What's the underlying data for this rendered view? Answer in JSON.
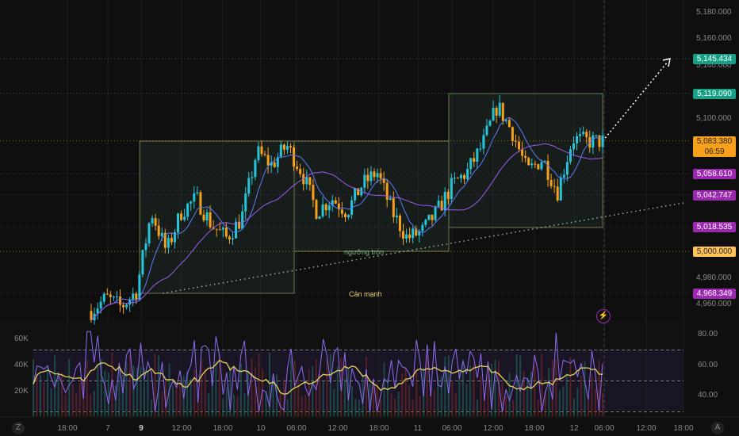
{
  "chart_data": {
    "type": "candlestick",
    "price_axis": {
      "ticks": [
        "5,180.000",
        "5,160.000",
        "5,140.000",
        "5,100.000",
        "4,980.000",
        "4,960.000"
      ],
      "range": [
        4955,
        5185
      ]
    },
    "price_labels": [
      {
        "value": 5145.434,
        "text": "5,145.434",
        "color": "#16a085"
      },
      {
        "value": 5119.09,
        "text": "5,119.090",
        "color": "#16a085"
      },
      {
        "value": 5083.38,
        "text": "5,083.380",
        "sub": "06:59",
        "color": "#f7a11a"
      },
      {
        "value": 5058.61,
        "text": "5,058.610",
        "color": "#9c27b0"
      },
      {
        "value": 5042.747,
        "text": "5,042.747",
        "color": "#9c27b0"
      },
      {
        "value": 5018.535,
        "text": "5,018.535",
        "color": "#9c27b0"
      },
      {
        "value": 5000.0,
        "text": "5,000.000",
        "color": "#ffc35a"
      },
      {
        "value": 4968.349,
        "text": "4,968.349",
        "color": "#9c27b0"
      }
    ],
    "time_ticks": [
      "18:00",
      "7",
      "9",
      "12:00",
      "18:00",
      "10",
      "06:00",
      "12:00",
      "18:00",
      "11",
      "06:00",
      "12:00",
      "18:00",
      "12",
      "06:00",
      "12:00",
      "18:00"
    ],
    "close_path": [
      4955,
      4965,
      4958,
      4970,
      5030,
      5000,
      5030,
      5040,
      5020,
      5010,
      5025,
      5075,
      5065,
      5080,
      5060,
      5030,
      5040,
      5030,
      5050,
      5060,
      5030,
      5010,
      5015,
      5030,
      5050,
      5060,
      5080,
      5110,
      5090,
      5060,
      5070,
      5045,
      5085,
      5083,
      5083
    ],
    "annotations": {
      "round_threshold": "ngưỡng tròn",
      "strong_resistance": "Cản mạnh"
    },
    "indicator": {
      "left_ticks": [
        "60K",
        "40K",
        "20K"
      ],
      "right_ticks": [
        "80.00",
        "60.00",
        "40.00"
      ],
      "levels": [
        70,
        50,
        30
      ]
    },
    "colors": {
      "up": "#26c6da",
      "down": "#f7a11a",
      "ma_fast": "#5c7cfa",
      "ma_slow": "#9c5cf0",
      "rsi": "#8e6cf0",
      "rsi_ma": "#e6d45a"
    }
  },
  "ui": {
    "z_button": "Z",
    "a_button": "A",
    "alert_icon": "⚡"
  }
}
